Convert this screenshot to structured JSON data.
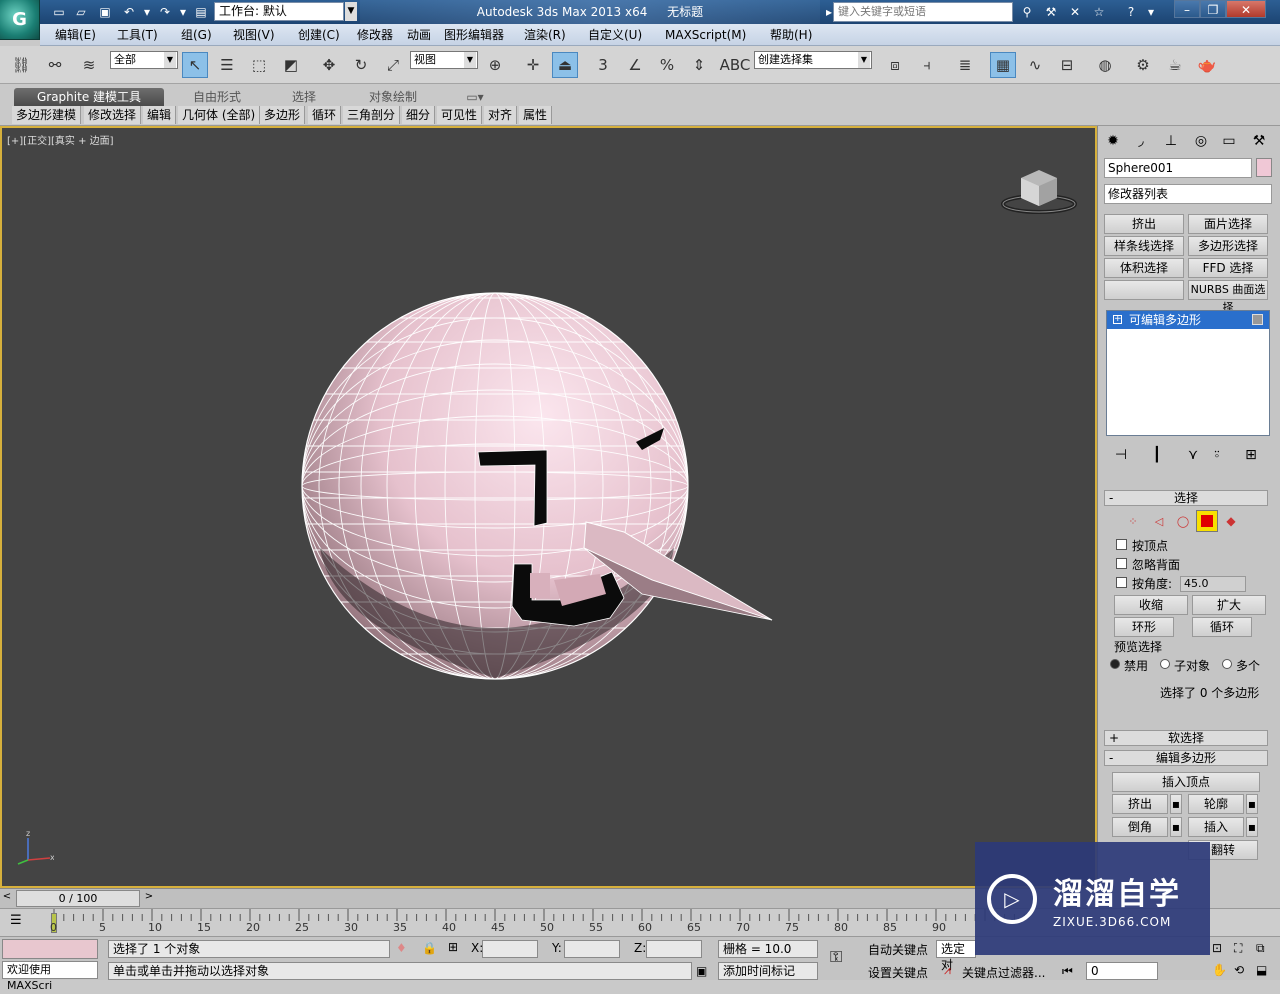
{
  "titlebar": {
    "workspace": "工作台: 默认",
    "app_name": "Autodesk 3ds Max  2013 x64",
    "doc_name": "无标题",
    "search_placeholder": "键入关键字或短语",
    "logo_letter": "G"
  },
  "menu": [
    "编辑(E)",
    "工具(T)",
    "组(G)",
    "视图(V)",
    "创建(C)",
    "修改器",
    "动画",
    "图形编辑器",
    "渲染(R)",
    "自定义(U)",
    "MAXScript(M)",
    "帮助(H)"
  ],
  "toolbar": {
    "selection_filter": "全部",
    "ref_coord": "视图",
    "named_selection": "创建选择集"
  },
  "ribbon": {
    "tabs": [
      "Graphite 建模工具",
      "自由形式",
      "选择",
      "对象绘制"
    ],
    "subtabs": [
      "多边形建模",
      "修改选择",
      "编辑",
      "几何体 (全部)",
      "多边形",
      "循环",
      "三角剖分",
      "细分",
      "可见性",
      "对齐",
      "属性"
    ]
  },
  "viewport": {
    "label": "[+][正交][真实 + 边面]",
    "object_color": "#f0d0dc",
    "bg_color": "#444444"
  },
  "command_panel": {
    "object_name": "Sphere001",
    "modifier_list": "修改器列表",
    "mod_buttons": [
      "挤出",
      "面片选择",
      "样条线选择",
      "多边形选择",
      "体积选择",
      "FFD 选择",
      "",
      "NURBS 曲面选择"
    ],
    "stack_item": "可编辑多边形",
    "selection": {
      "title": "选择",
      "by_vertex": "按顶点",
      "ignore_backface": "忽略背面",
      "by_angle": "按角度:",
      "angle_value": "45.0",
      "shrink": "收缩",
      "grow": "扩大",
      "ring": "环形",
      "loop": "循环",
      "preview_title": "预览选择",
      "preview_off": "禁用",
      "preview_sub": "子对象",
      "preview_multi": "多个",
      "status": "选择了 0 个多边形"
    },
    "soft_selection": "软选择",
    "edit_poly": {
      "title": "编辑多边形",
      "insert_vertex": "插入顶点",
      "extrude": "挤出",
      "outline": "轮廓",
      "bevel": "倒角",
      "inset": "插入",
      "flip": "翻转"
    }
  },
  "timeline": {
    "frame": "0 / 100",
    "ticks": [
      "0",
      "5",
      "10",
      "15",
      "20",
      "25",
      "30",
      "35",
      "40",
      "45",
      "50",
      "55",
      "60",
      "65",
      "70",
      "75",
      "80",
      "85",
      "90"
    ]
  },
  "status": {
    "welcome": "欢迎使用 MAXScri",
    "selected": "选择了 1 个对象",
    "prompt": "单击或单击并拖动以选择对象",
    "x_label": "X:",
    "y_label": "Y:",
    "z_label": "Z:",
    "grid": "栅格 = 10.0",
    "add_time_tag": "添加时间标记",
    "auto_key": "自动关键点",
    "set_key": "设置关键点",
    "selected_obj": "选定对",
    "key_filters": "关键点过滤器...",
    "frame_input": "0"
  },
  "watermark": {
    "title": "溜溜自学",
    "subtitle": "ZIXUE.3D66.COM"
  }
}
